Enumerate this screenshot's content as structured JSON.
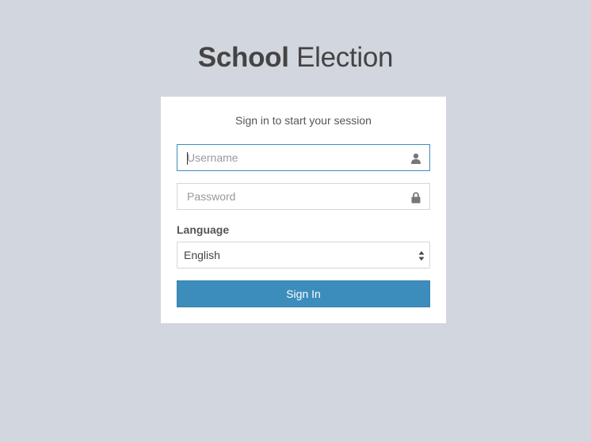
{
  "logo": {
    "bold": "School",
    "light": "Election"
  },
  "login": {
    "message": "Sign in to start your session",
    "username_placeholder": "Username",
    "username_value": "",
    "password_placeholder": "Password",
    "password_value": "",
    "language_label": "Language",
    "language_selected": "English",
    "signin_label": "Sign In"
  },
  "icons": {
    "username": "user-icon",
    "password": "lock-icon",
    "select": "sort-arrows-icon"
  },
  "colors": {
    "background": "#d2d6de",
    "primary": "#3c8dbc",
    "focus_border": "#3c8dbc"
  }
}
